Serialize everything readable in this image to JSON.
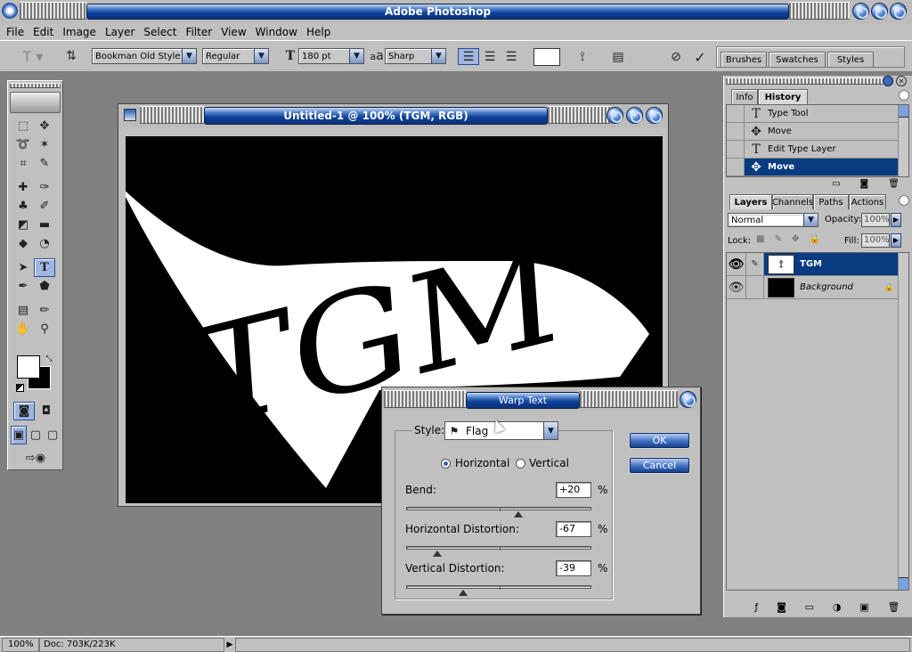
{
  "app": {
    "title": "Adobe Photoshop"
  },
  "menu": [
    "File",
    "Edit",
    "Image",
    "Layer",
    "Select",
    "Filter",
    "View",
    "Window",
    "Help"
  ],
  "options": {
    "font_family": "Bookman Old Style",
    "font_style": "Regular",
    "font_size": "180 pt",
    "aa_label": "a",
    "aa_label_big": "a",
    "antialias": "Sharp",
    "palette_tabs": [
      "Brushes",
      "Swatches",
      "Styles"
    ]
  },
  "document": {
    "title": "Untitled-1 @ 100% (TGM, RGB)",
    "text": "TGM"
  },
  "history": {
    "tabs": [
      "Info",
      "History"
    ],
    "items": [
      "Type Tool",
      "Move",
      "Edit Type Layer",
      "Move"
    ]
  },
  "layers": {
    "tabs": [
      "Layers",
      "Channels",
      "Paths",
      "Actions"
    ],
    "blend_mode": "Normal",
    "opacity_label": "Opacity:",
    "opacity": "100%",
    "lock_label": "Lock:",
    "fill_label": "Fill:",
    "fill": "100%",
    "rows": [
      "TGM",
      "Background"
    ]
  },
  "warp": {
    "title": "Warp Text",
    "style_label": "Style:",
    "style_value": "Flag",
    "horizontal": "Horizontal",
    "vertical": "Vertical",
    "bend_label": "Bend:",
    "bend": "+20",
    "hdist_label": "Horizontal Distortion:",
    "hdist": "-67",
    "vdist_label": "Vertical Distortion:",
    "vdist": "-39",
    "pct": "%",
    "ok": "OK",
    "cancel": "Cancel"
  },
  "status": {
    "zoom": "100%",
    "doc": "Doc: 703K/223K"
  }
}
